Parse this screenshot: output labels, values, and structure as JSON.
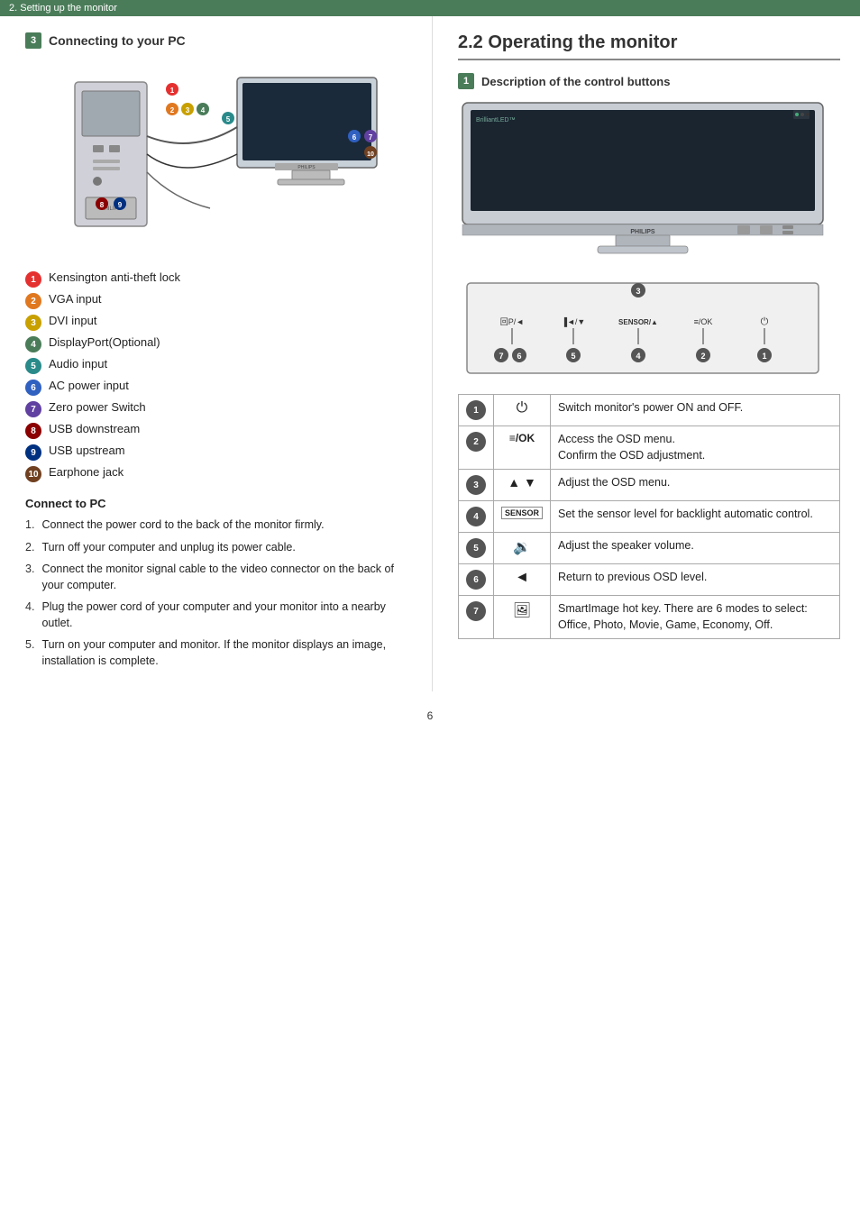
{
  "header": {
    "text": "2. Setting up the monitor"
  },
  "left": {
    "section3_title": "Connecting to your PC",
    "items": [
      {
        "num": "1",
        "text": "Kensington anti-theft lock",
        "color": "cn-red"
      },
      {
        "num": "2",
        "text": "VGA input",
        "color": "cn-orange"
      },
      {
        "num": "3",
        "text": "DVI input",
        "color": "cn-yellow"
      },
      {
        "num": "4",
        "text": "DisplayPort(Optional)",
        "color": "cn-green"
      },
      {
        "num": "5",
        "text": "Audio input",
        "color": "cn-teal"
      },
      {
        "num": "6",
        "text": "AC power input",
        "color": "cn-blue"
      },
      {
        "num": "7",
        "text": "Zero power Switch",
        "color": "cn-purple"
      },
      {
        "num": "8",
        "text": "USB downstream",
        "color": "cn-darkred"
      },
      {
        "num": "9",
        "text": "USB upstream",
        "color": "cn-darkblue"
      },
      {
        "num": "10",
        "text": "Earphone jack",
        "color": "cn-brown"
      }
    ],
    "connect_pc_title": "Connect to PC",
    "steps": [
      {
        "num": "1.",
        "text": "Connect the power cord to the back of the monitor firmly."
      },
      {
        "num": "2.",
        "text": "Turn off your computer and unplug its power cable."
      },
      {
        "num": "3.",
        "text": "Connect the monitor signal cable to the video connector on the back of your computer."
      },
      {
        "num": "4.",
        "text": "Plug the power cord of your computer and your monitor into a nearby outlet."
      },
      {
        "num": "5.",
        "text": "Turn on your computer and monitor. If the monitor displays an image, installation is complete."
      }
    ]
  },
  "right": {
    "section22_title": "2.2  Operating the monitor",
    "sub1_title": "Description of the control buttons",
    "table": [
      {
        "btn": "1",
        "icon": "power",
        "desc": "Switch monitor's power ON and OFF."
      },
      {
        "btn": "2",
        "icon": "menu_ok",
        "desc": "Access the OSD menu. Confirm the OSD adjustment."
      },
      {
        "btn": "3",
        "icon": "up_down",
        "desc": "Adjust the OSD menu."
      },
      {
        "btn": "4",
        "icon": "sensor",
        "desc": "Set the sensor level for backlight automatic control."
      },
      {
        "btn": "5",
        "icon": "speaker",
        "desc": "Adjust the speaker volume."
      },
      {
        "btn": "6",
        "icon": "back",
        "desc": "Return to previous OSD level."
      },
      {
        "btn": "7",
        "icon": "smartimage",
        "desc": "SmartImage hot key. There are 6 modes to select: Office, Photo, Movie, Game, Economy, Off."
      }
    ]
  },
  "page_number": "6"
}
